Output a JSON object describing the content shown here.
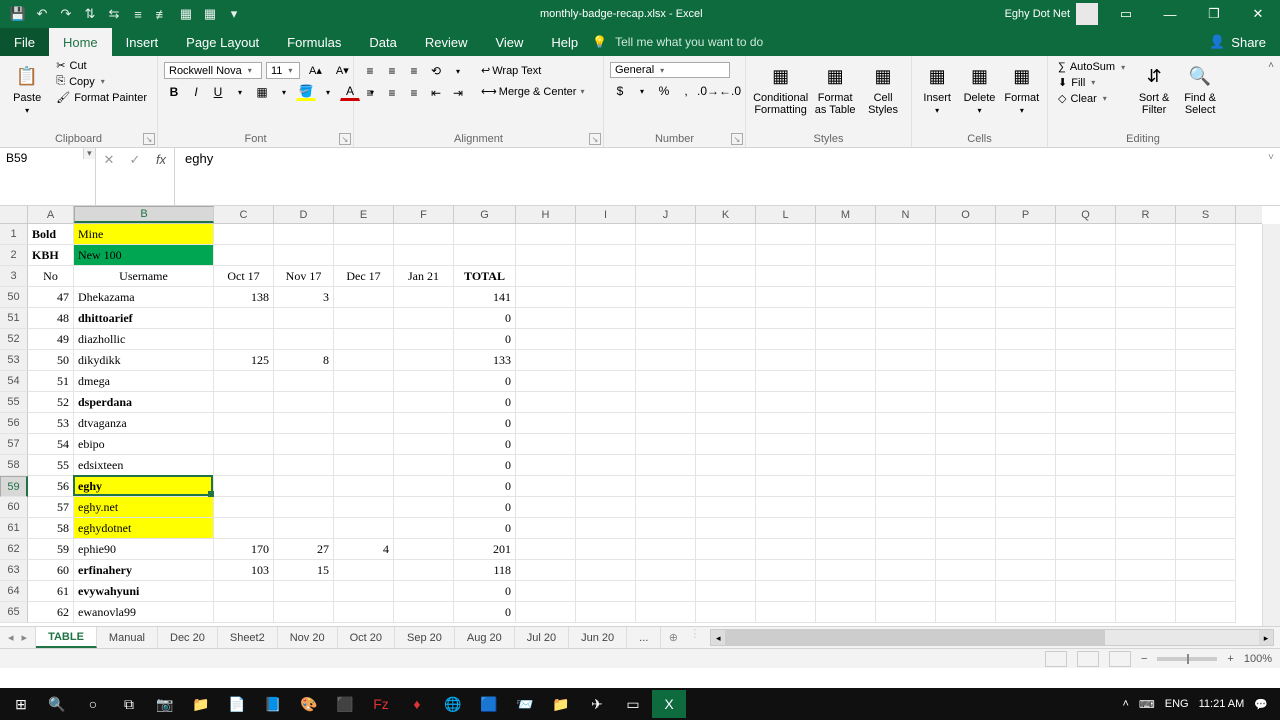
{
  "title": "monthly-badge-recap.xlsx - Excel",
  "user": "Eghy Dot Net",
  "tabs": [
    "File",
    "Home",
    "Insert",
    "Page Layout",
    "Formulas",
    "Data",
    "Review",
    "View",
    "Help"
  ],
  "tell_me": "Tell me what you want to do",
  "share": "Share",
  "clipboard": {
    "paste": "Paste",
    "cut": "Cut",
    "copy": "Copy",
    "fp": "Format Painter",
    "title": "Clipboard"
  },
  "font": {
    "name": "Rockwell Nova",
    "size": "11",
    "title": "Font"
  },
  "alignment": {
    "wrap": "Wrap Text",
    "merge": "Merge & Center",
    "title": "Alignment"
  },
  "number": {
    "fmt": "General",
    "title": "Number"
  },
  "styles": {
    "cond": "Conditional Formatting",
    "fat": "Format as Table",
    "cell": "Cell Styles",
    "title": "Styles"
  },
  "cells": {
    "ins": "Insert",
    "del": "Delete",
    "fmt": "Format",
    "title": "Cells"
  },
  "editing": {
    "sum": "AutoSum",
    "fill": "Fill",
    "clear": "Clear",
    "sort": "Sort & Filter",
    "find": "Find & Select",
    "title": "Editing"
  },
  "namebox": "B59",
  "formula": "eghy",
  "cols": {
    "A": 46,
    "B": 140,
    "C": 60,
    "D": 60,
    "E": 60,
    "F": 60,
    "G": 62,
    "H": 60,
    "I": 60,
    "J": 60,
    "K": 60,
    "L": 60,
    "M": 60,
    "N": 60,
    "O": 60,
    "P": 60,
    "Q": 60,
    "R": 60,
    "S": 60
  },
  "row_headers": [
    "1",
    "2",
    "3",
    "50",
    "51",
    "52",
    "53",
    "54",
    "55",
    "56",
    "57",
    "58",
    "59",
    "60",
    "61",
    "62",
    "63",
    "64",
    "65"
  ],
  "selected_row_index": 12,
  "rows": [
    {
      "a": "Bold",
      "b": "Mine",
      "a_bold": true,
      "b_yellow": true,
      "a_left": true
    },
    {
      "a": "KBH",
      "b": "New 100",
      "a_bold": true,
      "b_green": true,
      "a_left": true
    },
    {
      "a": "No",
      "b": "Username",
      "c": "Oct 17",
      "d": "Nov 17",
      "e": "Dec 17",
      "f": "Jan 21",
      "g": "TOTAL",
      "hdr": true,
      "a_center": true,
      "b_center": true,
      "g_bold": true
    },
    {
      "a": "47",
      "b": "Dhekazama",
      "c": "138",
      "d": "3",
      "g": "141"
    },
    {
      "a": "48",
      "b": "dhittoarief",
      "b_bold": true,
      "g": "0"
    },
    {
      "a": "49",
      "b": "diazhollic",
      "g": "0"
    },
    {
      "a": "50",
      "b": "dikydikk",
      "c": "125",
      "d": "8",
      "g": "133"
    },
    {
      "a": "51",
      "b": "dmega",
      "g": "0"
    },
    {
      "a": "52",
      "b": "dsperdana",
      "b_bold": true,
      "g": "0"
    },
    {
      "a": "53",
      "b": "dtvaganza",
      "g": "0"
    },
    {
      "a": "54",
      "b": "ebipo",
      "g": "0"
    },
    {
      "a": "55",
      "b": "edsixteen",
      "g": "0"
    },
    {
      "a": "56",
      "b": "eghy",
      "b_bold": true,
      "b_yellow": true,
      "g": "0"
    },
    {
      "a": "57",
      "b": "eghy.net",
      "b_yellow": true,
      "g": "0"
    },
    {
      "a": "58",
      "b": "eghydotnet",
      "b_yellow": true,
      "g": "0"
    },
    {
      "a": "59",
      "b": "ephie90",
      "c": "170",
      "d": "27",
      "e": "4",
      "g": "201"
    },
    {
      "a": "60",
      "b": "erfinahery",
      "b_bold": true,
      "c": "103",
      "d": "15",
      "g": "118"
    },
    {
      "a": "61",
      "b": "evywahyuni",
      "b_bold": true,
      "g": "0"
    },
    {
      "a": "62",
      "b": "ewanovla99",
      "g": "0"
    }
  ],
  "sheets": [
    "TABLE",
    "Manual",
    "Dec 20",
    "Sheet2",
    "Nov 20",
    "Oct 20",
    "Sep 20",
    "Aug 20",
    "Jul 20",
    "Jun 20"
  ],
  "active_sheet": 0,
  "zoom": "100%",
  "tray": {
    "lang": "ENG",
    "time": "11:21 AM"
  },
  "chart_data": null
}
